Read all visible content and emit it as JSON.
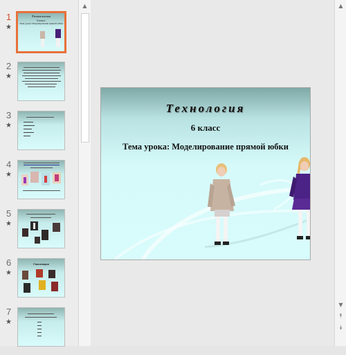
{
  "thumbnails": [
    {
      "number": "1",
      "selected": true,
      "title": "Технология",
      "grade": "6 класс",
      "topic": "Тема урока: Моделирование прямой юбки"
    },
    {
      "number": "2",
      "selected": false
    },
    {
      "number": "3",
      "selected": false
    },
    {
      "number": "4",
      "selected": false
    },
    {
      "number": "5",
      "selected": false
    },
    {
      "number": "6",
      "selected": false,
      "title": "Стилизация"
    },
    {
      "number": "7",
      "selected": false
    }
  ],
  "slide": {
    "title": "Технология",
    "grade": "6 класс",
    "topic": "Тема урока: Моделирование прямой юбки"
  },
  "scrollbar": {
    "up_icon": "▲",
    "down_icon": "▼",
    "prev_slide_icon": "⯭",
    "next_slide_icon": "⯯"
  },
  "star_icon": "★",
  "colors": {
    "selected_border": "#e8703a",
    "selected_number": "#d24726",
    "slide_bg": "#d8fbfb"
  }
}
